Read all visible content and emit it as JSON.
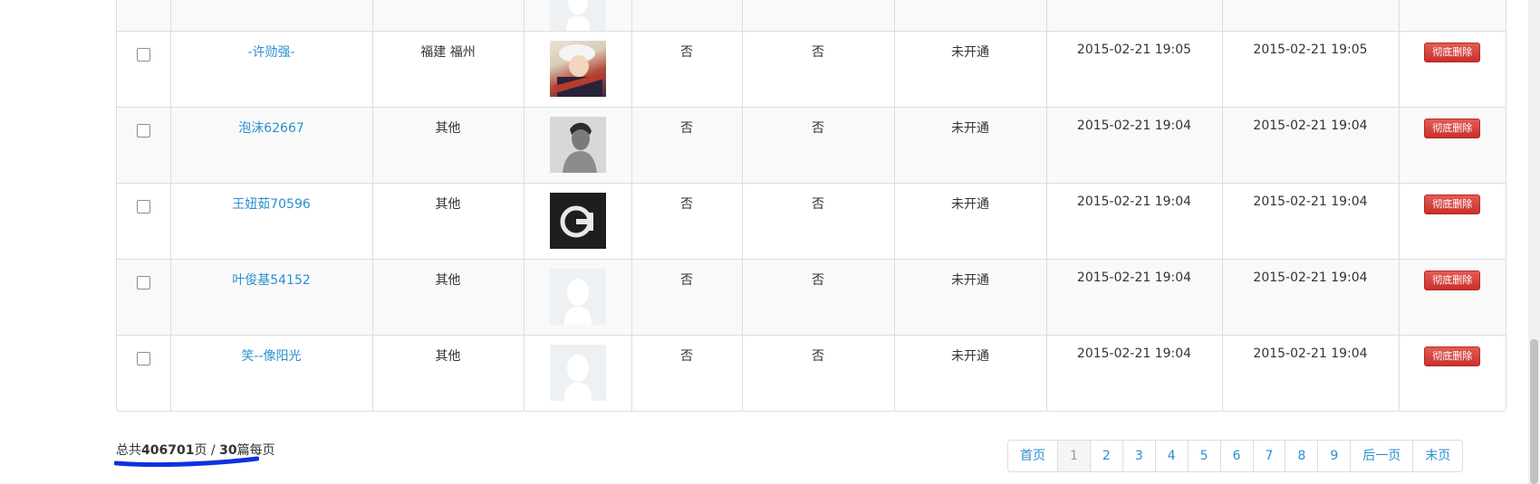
{
  "rows": [
    {
      "name": "-许勋强-",
      "region": "福建 福州",
      "avatar": "anime-avatar",
      "col4": "否",
      "col5": "否",
      "status": "未开通",
      "time1": "2015-02-21 19:05",
      "time2": "2015-02-21 19:05",
      "delete_label": "彻底删除"
    },
    {
      "name": "泡沫62667",
      "region": "其他",
      "avatar": "photo-avatar",
      "col4": "否",
      "col5": "否",
      "status": "未开通",
      "time1": "2015-02-21 19:04",
      "time2": "2015-02-21 19:04",
      "delete_label": "彻底删除"
    },
    {
      "name": "王妞茹70596",
      "region": "其他",
      "avatar": "logo-avatar",
      "col4": "否",
      "col5": "否",
      "status": "未开通",
      "time1": "2015-02-21 19:04",
      "time2": "2015-02-21 19:04",
      "delete_label": "彻底删除"
    },
    {
      "name": "叶俊基54152",
      "region": "其他",
      "avatar": "default-avatar",
      "col4": "否",
      "col5": "否",
      "status": "未开通",
      "time1": "2015-02-21 19:04",
      "time2": "2015-02-21 19:04",
      "delete_label": "彻底删除"
    },
    {
      "name": "笑--像阳光",
      "region": "其他",
      "avatar": "default-avatar",
      "col4": "否",
      "col5": "否",
      "status": "未开通",
      "time1": "2015-02-21 19:04",
      "time2": "2015-02-21 19:04",
      "delete_label": "彻底删除"
    }
  ],
  "footer": {
    "prefix": "总共",
    "total_pages": "406701",
    "pages_unit": "页 / ",
    "per_page": "30",
    "per_page_unit": "篇",
    "suffix": "每页"
  },
  "pagination": {
    "first": "首页",
    "pages": [
      "1",
      "2",
      "3",
      "4",
      "5",
      "6",
      "7",
      "8",
      "9"
    ],
    "active": "1",
    "next": "后一页",
    "last": "末页"
  },
  "colors": {
    "link": "#2a8fd0",
    "delete": "#d9534f",
    "annotation": "#1030e0"
  }
}
